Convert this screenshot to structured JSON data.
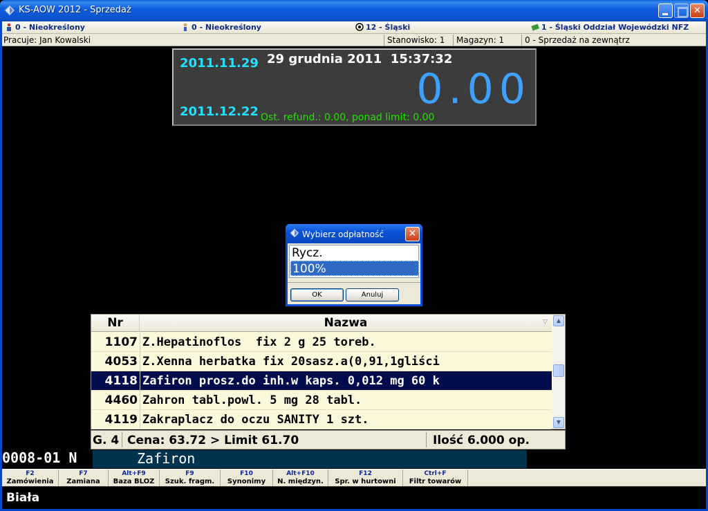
{
  "window": {
    "title": "KS-AOW 2012 - Sprzedaż",
    "app_icon": "pill-icon"
  },
  "infobar": {
    "doctor": "0 - Nieokreślony",
    "patient": "0 - Nieokreślony",
    "region": "12 - Śląski",
    "nfz": "1 - Śląski Oddział Wojewódzki NFZ"
  },
  "statusbar": {
    "worker": "Pracuje: Jan Kowalski",
    "station": "Stanowisko: 1",
    "warehouse": "Magazyn: 1",
    "sale_type": "0 - Sprzedaż na zewnątrz"
  },
  "display": {
    "date1": "2011.11.29",
    "date2": "2011.12.22",
    "datetime": "29 grudnia 2011  15:37:32",
    "amount": "0.00",
    "refund": "Ost. refund.: 0.00, ponad limit: 0.00"
  },
  "dialog": {
    "title": "Wybierz odpłatność",
    "options": [
      "Rycz.",
      "100%"
    ],
    "selected_index": 1,
    "ok_label": "OK",
    "cancel_label": "Anuluj"
  },
  "grid": {
    "headers": [
      "Nr",
      "Nazwa"
    ],
    "rows": [
      {
        "nr": "1107",
        "name": "Z.Hepatinoflos  fix 2 g 25 toreb."
      },
      {
        "nr": "4053",
        "name": "Z.Xenna herbatka fix 20sasz.a(0,91,1gliści"
      },
      {
        "nr": "4118",
        "name": "Zafiron prosz.do inh.w kaps. 0,012 mg 60 k"
      },
      {
        "nr": "4460",
        "name": "Zahron tabl.powl. 5 mg 28 tabl."
      },
      {
        "nr": "4119",
        "name": "Zakraplacz do oczu SANITY 1 szt."
      }
    ],
    "selected_row": 2
  },
  "info": {
    "group": "G. 4",
    "price": "Cena: 63.72 > Limit 61.70",
    "quantity": "Ilość 6.000 op."
  },
  "input": {
    "code": "0008-01 N",
    "value": "Zafiron"
  },
  "fkeys": [
    {
      "key": "F2",
      "label": "Zamówienia"
    },
    {
      "key": "F7",
      "label": "Zamiana"
    },
    {
      "key": "Alt+F9",
      "label": "Baza BLOZ"
    },
    {
      "key": "F9",
      "label": "Szuk. fragm."
    },
    {
      "key": "F10",
      "label": "Synonimy"
    },
    {
      "key": "Alt+F10",
      "label": "N. międzyn."
    },
    {
      "key": "F12",
      "label": "Spr. w hurtowni"
    },
    {
      "key": "Ctrl+F",
      "label": "Filtr towarów"
    }
  ],
  "bottom": {
    "text": "Biała"
  }
}
